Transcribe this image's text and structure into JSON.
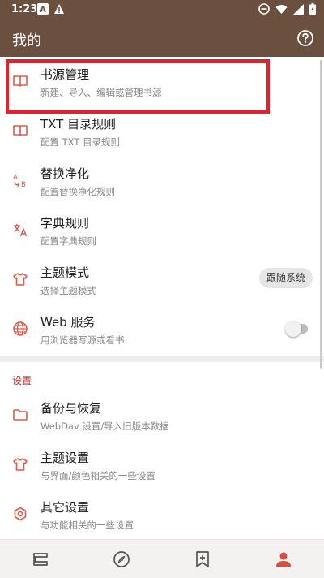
{
  "status_bar": {
    "time": "1:23",
    "icons": [
      "a-icon",
      "warning-icon",
      "dnd-icon",
      "wifi-icon",
      "signal-icon",
      "battery-icon"
    ]
  },
  "app_bar": {
    "title": "我的",
    "help_icon": "help-circle-icon"
  },
  "items": [
    {
      "id": "book-source",
      "title": "书源管理",
      "subtitle": "新建、导入、编辑或管理书源",
      "icon": "book-icon"
    },
    {
      "id": "txt-toc",
      "title": "TXT 目录规则",
      "subtitle": "配置 TXT 目录规则",
      "icon": "book-icon"
    },
    {
      "id": "replace",
      "title": "替换净化",
      "subtitle": "配置替换净化规则",
      "icon": "replace-ab-icon"
    },
    {
      "id": "dict",
      "title": "字典规则",
      "subtitle": "配置字典规则",
      "icon": "translate-icon"
    },
    {
      "id": "theme-mode",
      "title": "主题模式",
      "subtitle": "选择主题模式",
      "icon": "tshirt-icon",
      "chip": "跟随系统"
    },
    {
      "id": "web-service",
      "title": "Web 服务",
      "subtitle": "用浏览器写源或看书",
      "icon": "globe-icon",
      "toggle": false
    }
  ],
  "settings_section": {
    "label": "设置",
    "items": [
      {
        "id": "backup",
        "title": "备份与恢复",
        "subtitle": "WebDav 设置/导入旧版本数据",
        "icon": "folder-icon"
      },
      {
        "id": "theme-settings",
        "title": "主题设置",
        "subtitle": "与界面/颜色相关的一些设置",
        "icon": "tshirt-icon"
      },
      {
        "id": "other-settings",
        "title": "其它设置",
        "subtitle": "与功能相关的一些设置",
        "icon": "gear-icon"
      }
    ]
  },
  "bottom_nav": [
    {
      "id": "bookshelf",
      "icon": "bookshelf-icon",
      "active": false
    },
    {
      "id": "discover",
      "icon": "compass-icon",
      "active": false
    },
    {
      "id": "rss",
      "icon": "bookmark-add-icon",
      "active": false
    },
    {
      "id": "my",
      "icon": "person-icon",
      "active": true
    }
  ],
  "colors": {
    "primary": "#6b4f3f",
    "accent": "#e04a3a",
    "icon_red": "#e05a4a",
    "highlight_border": "#e2222a"
  }
}
